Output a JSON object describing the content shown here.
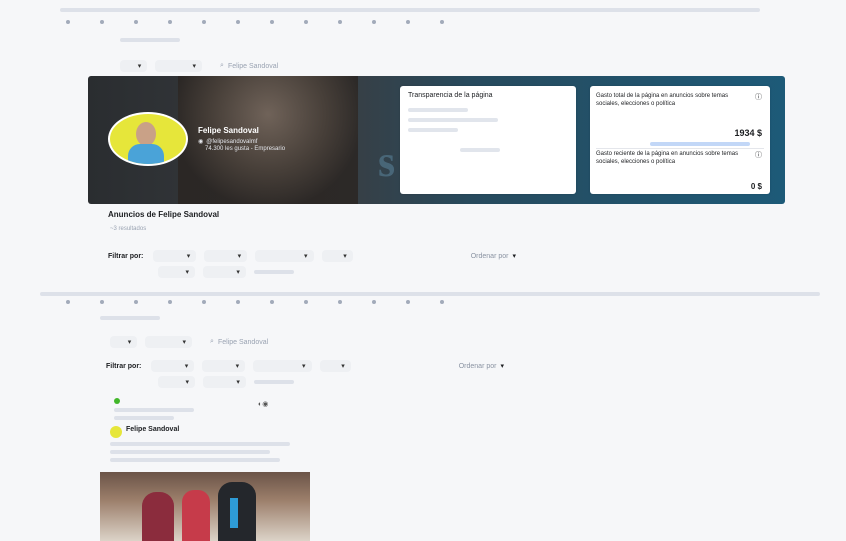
{
  "top_section": {
    "filter_label": "Filtrar por:",
    "sort_label": "Ordenar por",
    "sort_label_bottom": "Ordenar por",
    "search_placeholder": "Felipe Sandoval",
    "results_label": "~3 resultados"
  },
  "banner": {
    "page_name": "Felipe Sandoval",
    "handle": "@felipesandovalmf",
    "followers": "74.300 les gusta - Empresario",
    "transparency_title": "Transparencia de la página",
    "spend_card_title": "Gasto total de la página en anuncios sobre temas sociales, elecciones o política",
    "spend_value": "1934 $",
    "recent_spend_title": "Gasto reciente de la página en anuncios sobre temas sociales, elecciones o política",
    "recent_value": "0 $"
  },
  "ads_heading": "Anuncios de Felipe Sandoval",
  "bottom_section": {
    "filter_label": "Filtrar por:",
    "search_placeholder": "Felipe Sandoval"
  },
  "ad_card": {
    "advertiser": "Felipe Sandoval"
  },
  "colors": {
    "banner_bg": "#2d3033",
    "accent_blue": "#1877f2",
    "avatar_bg": "#e6e63a"
  }
}
